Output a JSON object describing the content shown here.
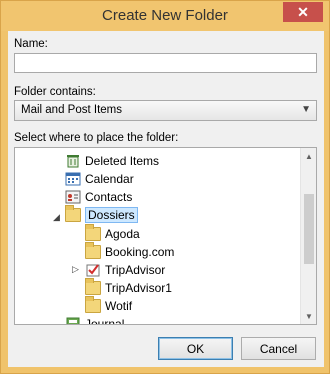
{
  "window": {
    "title": "Create New Folder",
    "close_glyph": "✕"
  },
  "name_field": {
    "label": "Name:",
    "value": ""
  },
  "folder_contains": {
    "label": "Folder contains:",
    "selected": "Mail and Post Items"
  },
  "tree": {
    "label": "Select where to place the folder:",
    "items": [
      {
        "label": "Deleted Items",
        "icon": "deleted-items-icon"
      },
      {
        "label": "Calendar",
        "icon": "calendar-icon"
      },
      {
        "label": "Contacts",
        "icon": "contacts-icon"
      },
      {
        "label": "Dossiers",
        "icon": "folder-icon",
        "expanded": true,
        "selected": true
      },
      {
        "label": "Agoda",
        "icon": "folder-icon"
      },
      {
        "label": "Booking.com",
        "icon": "folder-icon"
      },
      {
        "label": "TripAdvisor",
        "icon": "tasks-folder-icon",
        "collapsed": true
      },
      {
        "label": "TripAdvisor1",
        "icon": "folder-icon"
      },
      {
        "label": "Wotif",
        "icon": "folder-icon"
      },
      {
        "label": "Journal",
        "icon": "journal-icon"
      }
    ]
  },
  "buttons": {
    "ok": "OK",
    "cancel": "Cancel"
  }
}
